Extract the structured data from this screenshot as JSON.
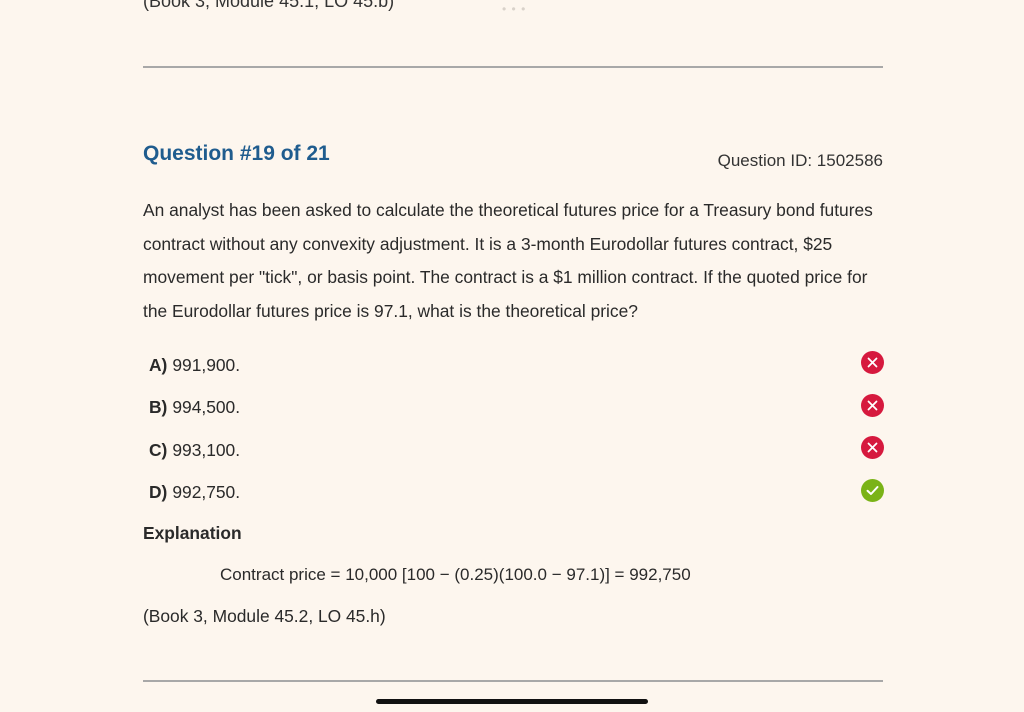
{
  "previous_reference": "(Book 3, Module 45.1, LO 45.b)",
  "question": {
    "title": "Question #19 of 21",
    "id_label": "Question ID: 1502586",
    "text": "An analyst has been asked to calculate the theoretical futures price for a Treasury bond futures contract without any convexity adjustment. It is a 3-month Eurodollar futures contract, $25 movement per \"tick\", or basis point. The contract is a $1 million contract. If the quoted price for the Eurodollar futures price is 97.1, what is the theoretical price?"
  },
  "options": [
    {
      "letter": "A)",
      "text": "991,900.",
      "status": "incorrect",
      "icon": "x-circle-icon"
    },
    {
      "letter": "B)",
      "text": "994,500.",
      "status": "incorrect",
      "icon": "x-circle-icon"
    },
    {
      "letter": "C)",
      "text": "993,100.",
      "status": "incorrect",
      "icon": "x-circle-icon"
    },
    {
      "letter": "D)",
      "text": "992,750.",
      "status": "correct",
      "icon": "check-circle-icon"
    }
  ],
  "explanation": {
    "heading": "Explanation",
    "formula": "Contract price = 10,000 [100 − (0.25)(100.0 − 97.1)] = 992,750",
    "reference": "(Book 3, Module 45.2, LO 45.h)"
  },
  "colors": {
    "background": "#fdf6ee",
    "title": "#1f5c8e",
    "incorrect": "#d6193e",
    "correct": "#7ab317"
  }
}
